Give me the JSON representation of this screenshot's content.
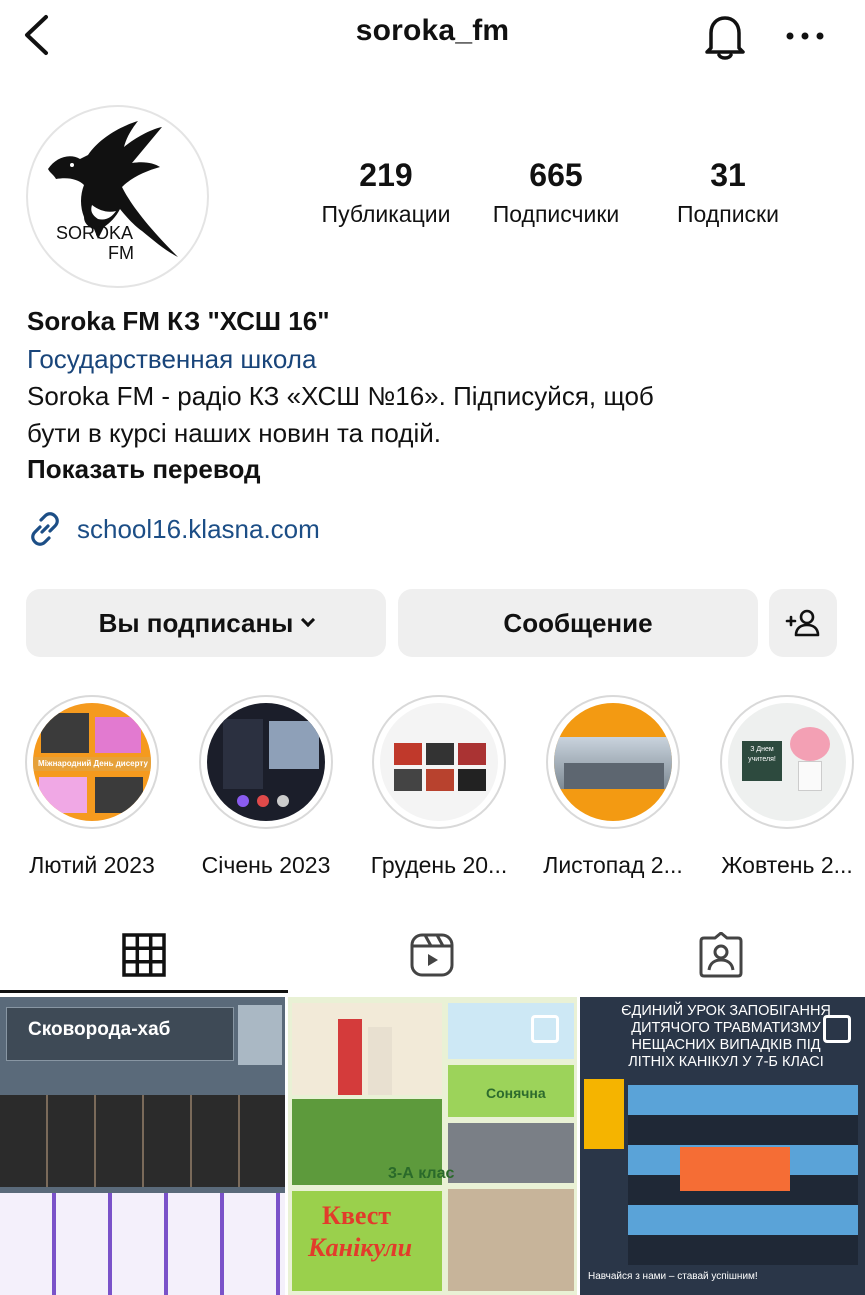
{
  "header": {
    "username": "soroka_fm"
  },
  "avatar": {
    "line1": "SOROKA",
    "line2": "FM"
  },
  "stats": {
    "posts": {
      "value": "219",
      "label": "Публикации"
    },
    "followers": {
      "value": "665",
      "label": "Подписчики"
    },
    "following": {
      "value": "31",
      "label": "Подписки"
    }
  },
  "bio": {
    "name": "Soroka FM КЗ \"ХСШ 16\"",
    "category": "Государственная школа",
    "desc_line1": "Soroka FM - радіо КЗ «ХСШ №16». Підписуйся, щоб",
    "desc_line2": "бути в курсі наших новин та подій.",
    "translate": "Показать перевод",
    "link": "school16.klasna.com"
  },
  "actions": {
    "following": "Вы подписаны",
    "message": "Сообщение"
  },
  "highlights": [
    {
      "label": "Лютий 2023",
      "banner": "Міжнародний День дисерту"
    },
    {
      "label": "Січень 2023"
    },
    {
      "label": "Грудень 20..."
    },
    {
      "label": "Листопад 2..."
    },
    {
      "label": "Жовтень 2...",
      "card": "З Днем учителя!"
    }
  ],
  "posts": [
    {
      "title": "Сковорода-хаб"
    },
    {
      "t1": "Сонячна",
      "t2": "3-А клас",
      "t3": "Квест",
      "t4": "Канікули"
    },
    {
      "line1": "ЄДИНИЙ УРОК ЗАПОБІГАННЯ",
      "line2": "ДИТЯЧОГО ТРАВМАТИЗМУ",
      "line3": "НЕЩАСНИХ ВИПАДКІВ ПІД",
      "line4": "ЛІТНІХ КАНІКУЛ У 7-Б КЛАСІ",
      "footer": "Навчайся з нами – ставай успішним!"
    }
  ],
  "colors": {
    "link": "#1c4e86",
    "category": "#19457a",
    "button_bg": "#efefef"
  }
}
